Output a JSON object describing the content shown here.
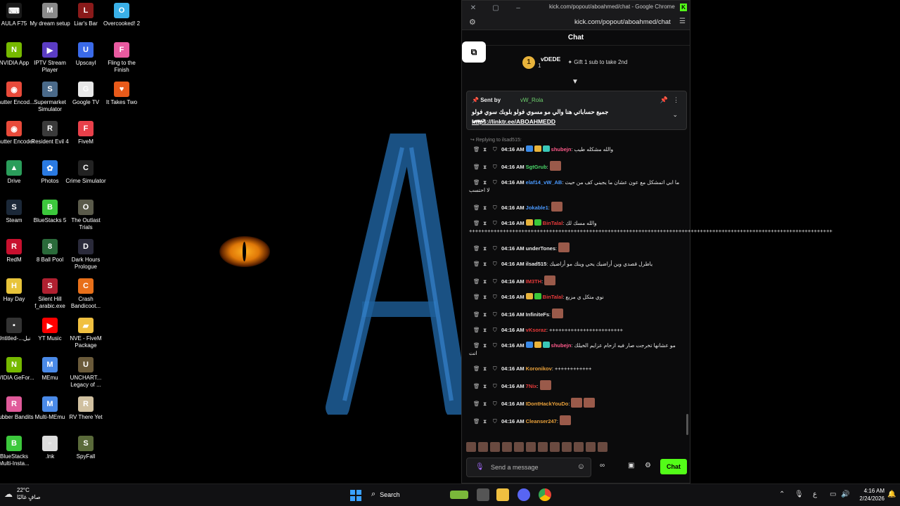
{
  "desktop": {
    "icons": [
      {
        "label": "AULA F75",
        "color": "#1a1a1a",
        "glyph": "⌨"
      },
      {
        "label": "NVIDIA App",
        "color": "#76b900",
        "glyph": "N"
      },
      {
        "label": "Shutter Encod...",
        "color": "#e84a3a",
        "glyph": "◉"
      },
      {
        "label": "Shutter Encoder",
        "color": "#e84a3a",
        "glyph": "◉"
      },
      {
        "label": "Drive",
        "color": "#2a9d5a",
        "glyph": "▲"
      },
      {
        "label": "Steam",
        "color": "#1b2838",
        "glyph": "S"
      },
      {
        "label": "RedM",
        "color": "#c8102e",
        "glyph": "R"
      },
      {
        "label": "Hay Day",
        "color": "#e8c43a",
        "glyph": "H"
      },
      {
        "label": "Untitled-...نبل",
        "color": "#333333",
        "glyph": "▪"
      },
      {
        "label": "NVIDIA GeFor...",
        "color": "#76b900",
        "glyph": "N"
      },
      {
        "label": "Rubber Bandits",
        "color": "#e05a9a",
        "glyph": "R"
      },
      {
        "label": "BlueStacks Multi-Insta...",
        "color": "#3cc83c",
        "glyph": "B"
      },
      {
        "label": "My dream setup",
        "color": "#8a8a8a",
        "glyph": "M"
      },
      {
        "label": "IPTV Stream Player",
        "color": "#5b3cc4",
        "glyph": "▶"
      },
      {
        "label": "Supermarket Simulator",
        "color": "#4a6a8a",
        "glyph": "S"
      },
      {
        "label": "Resident Evil 4",
        "color": "#3a3a3a",
        "glyph": "R"
      },
      {
        "label": "Photos",
        "color": "#2a7ae2",
        "glyph": "✿"
      },
      {
        "label": "BlueStacks 5",
        "color": "#3cc83c",
        "glyph": "B"
      },
      {
        "label": "8 Ball Pool",
        "color": "#2a6a3a",
        "glyph": "8"
      },
      {
        "label": "Silent Hill f_arabic.exe",
        "color": "#b02030",
        "glyph": "S"
      },
      {
        "label": "YT Music",
        "color": "#ff0000",
        "glyph": "▶"
      },
      {
        "label": "MEmu",
        "color": "#4a8ae8",
        "glyph": "M"
      },
      {
        "label": "Multi-MEmu",
        "color": "#4a8ae8",
        "glyph": "M"
      },
      {
        "label": ".lnk",
        "color": "#dddddd",
        "glyph": "▫"
      },
      {
        "label": "Liar's Bar",
        "color": "#8a1a1a",
        "glyph": "L"
      },
      {
        "label": "Upscayl",
        "color": "#3a6ae8",
        "glyph": "U"
      },
      {
        "label": "Google TV",
        "color": "#e8e8e8",
        "glyph": "G"
      },
      {
        "label": "FiveM",
        "color": "#e8404a",
        "glyph": "F"
      },
      {
        "label": "Crime Simulator",
        "color": "#222222",
        "glyph": "C"
      },
      {
        "label": "The Outlast Trials",
        "color": "#5a5a4a",
        "glyph": "O"
      },
      {
        "label": "Dark Hours Prologue",
        "color": "#2a2a3a",
        "glyph": "D"
      },
      {
        "label": "Crash Bandicoot...",
        "color": "#e8701a",
        "glyph": "C"
      },
      {
        "label": "NVE - FiveM Package",
        "color": "#f0c040",
        "glyph": "▰"
      },
      {
        "label": "UNCHART... Legacy of ...",
        "color": "#6a5a3a",
        "glyph": "U"
      },
      {
        "label": "RV There Yet",
        "color": "#d0c0a0",
        "glyph": "R"
      },
      {
        "label": "SpyFall",
        "color": "#5a6a3a",
        "glyph": "S"
      },
      {
        "label": "Overcooked! 2",
        "color": "#3ab0e8",
        "glyph": "O"
      },
      {
        "label": "Fling to the Finish",
        "color": "#e85aa0",
        "glyph": "F"
      },
      {
        "label": "It Takes Two",
        "color": "#e85a1a",
        "glyph": "♥"
      }
    ]
  },
  "browser": {
    "title": "kick.com/popout/aboahmed/chat - Google Chrome",
    "url": "kick.com/popout/aboahmed/chat"
  },
  "chat": {
    "header": "Chat",
    "leaderboard": {
      "rank": "1",
      "name": "vDEDE",
      "count": "1",
      "gift_text": "Gift 1 sub to take 2nd"
    },
    "pinned": {
      "sent_by": "Sent by",
      "sender": "vW_Rola",
      "message": "جميع حساباتي هنا والي مو مسوي فولو بلوبك سوي فولو حبيبي",
      "link": "https://linktr.ee/ABOAHMEDD"
    },
    "reply_context": "Replying to ilsad515:",
    "messages": [
      {
        "time": "04:16 AM",
        "user": "shubejn",
        "color": "#ff5a8a",
        "text": "والله مشكله طيب",
        "emotes": 0,
        "badges": [
          "#3a8ae8",
          "#e8b33b",
          "#3ac8b8"
        ]
      },
      {
        "time": "04:16 AM",
        "user": "SgtGrub",
        "color": "#4ad86a",
        "text": "",
        "emotes": 1,
        "badges": []
      },
      {
        "time": "04:16 AM",
        "user": "elaf14_vW_AB",
        "color": "#4a9aff",
        "text": "ما ابي اتمشكل مع عون عشان ما يجيني كف من حيث لا احتسب",
        "emotes": 0,
        "badges": []
      },
      {
        "time": "04:16 AM",
        "user": "Jokable1",
        "color": "#4a9aff",
        "text": "",
        "emotes": 1,
        "badges": []
      },
      {
        "time": "04:16 AM",
        "user": "BinTalal",
        "color": "#e83a3a",
        "text": "والله مسك لك ++++++++++++++++++++++++++++++++++++++++++++++++++++++++++++++++++++++++++++++++++++++++++++++++++++++++++++++++++++++",
        "emotes": 0,
        "badges": [
          "#e8b33b",
          "#3ac83a"
        ]
      },
      {
        "time": "04:16 AM",
        "user": "underTones",
        "color": "#e8e8e8",
        "text": "",
        "emotes": 1,
        "badges": []
      },
      {
        "time": "04:16 AM",
        "user": "ilsad515",
        "color": "#e8e8e8",
        "text": "ياطرل قصدي وين أراضيك يحي وينك مو أراضيك",
        "emotes": 0,
        "badges": []
      },
      {
        "time": "04:16 AM",
        "user": "IM3TH",
        "color": "#e83a3a",
        "text": "",
        "emotes": 1,
        "badges": []
      },
      {
        "time": "04:16 AM",
        "user": "BinTalal",
        "color": "#e83a3a",
        "text": "نوي متكل ي مزبع",
        "emotes": 0,
        "badges": [
          "#e8b33b",
          "#3ac83a"
        ]
      },
      {
        "time": "04:16 AM",
        "user": "InfiniteFs",
        "color": "#e8e8e8",
        "text": "",
        "emotes": 1,
        "badges": []
      },
      {
        "time": "04:16 AM",
        "user": "vKsoraz",
        "color": "#e83a3a",
        "text": "++++++++++++++++++++++++",
        "emotes": 0,
        "badges": []
      },
      {
        "time": "04:16 AM",
        "user": "shubejn",
        "color": "#ff5a8a",
        "text": "مو عشانها تخرجت صار فيه ازحام عزايم الخيلك انت",
        "emotes": 0,
        "badges": [
          "#3a8ae8",
          "#e8b33b",
          "#3ac8b8"
        ]
      },
      {
        "time": "04:16 AM",
        "user": "Koronikov",
        "color": "#e8a03a",
        "text": "++++++++++++",
        "emotes": 0,
        "badges": []
      },
      {
        "time": "04:16 AM",
        "user": "7Nix",
        "color": "#e83a3a",
        "text": "",
        "emotes": 1,
        "badges": []
      },
      {
        "time": "04:16 AM",
        "user": "IDontHackYouDo",
        "color": "#e8a03a",
        "text": "",
        "emotes": 2,
        "badges": []
      },
      {
        "time": "04:16 AM",
        "user": "Cleanser247",
        "color": "#e8a03a",
        "text": "",
        "emotes": 1,
        "badges": []
      }
    ],
    "input_placeholder": "Send a message",
    "send_label": "Chat"
  },
  "taskbar": {
    "weather_temp": "22°C",
    "weather_desc": "صافٍ غالبًا",
    "search_label": "Search",
    "lang": "ع",
    "time": "4:16 AM",
    "date": "2/24/2026"
  }
}
